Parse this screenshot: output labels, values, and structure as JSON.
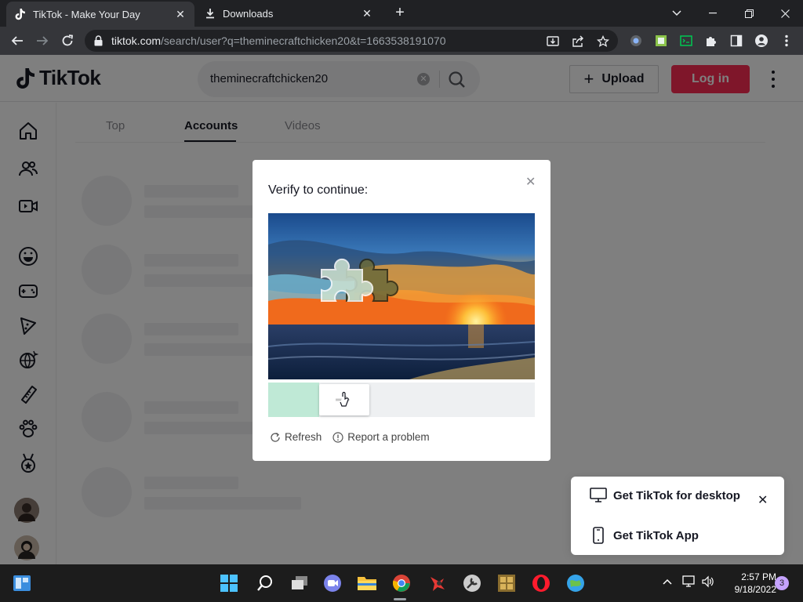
{
  "browser": {
    "tabs": [
      {
        "title": "TikTok - Make Your Day",
        "icon": "tiktok-icon",
        "active": true
      },
      {
        "title": "Downloads",
        "icon": "download-icon",
        "active": false
      }
    ],
    "url_host": "tiktok.com",
    "url_path": "/search/user?q=theminecraftchicken20&t=1663538191070"
  },
  "tiktok": {
    "logo_text": "TikTok",
    "search_value": "theminecraftchicken20",
    "upload_label": "Upload",
    "login_label": "Log in",
    "brand_color": "#fe2c55",
    "result_tabs": [
      {
        "label": "Top",
        "active": false
      },
      {
        "label": "Accounts",
        "active": true
      },
      {
        "label": "Videos",
        "active": false
      }
    ],
    "sidebar_icons": [
      "home-icon",
      "following-icon",
      "live-icon",
      "comedy-icon",
      "gaming-icon",
      "food-icon",
      "dance-icon",
      "beauty-icon",
      "animals-icon",
      "sports-icon"
    ]
  },
  "captcha": {
    "title": "Verify to continue:",
    "refresh_label": "Refresh",
    "report_label": "Report a problem",
    "slider_progress": 0.19
  },
  "get_app": {
    "desktop_label": "Get TikTok for desktop",
    "app_label": "Get TikTok App"
  },
  "taskbar": {
    "time": "2:57 PM",
    "date": "9/18/2022",
    "notification_count": "3"
  }
}
